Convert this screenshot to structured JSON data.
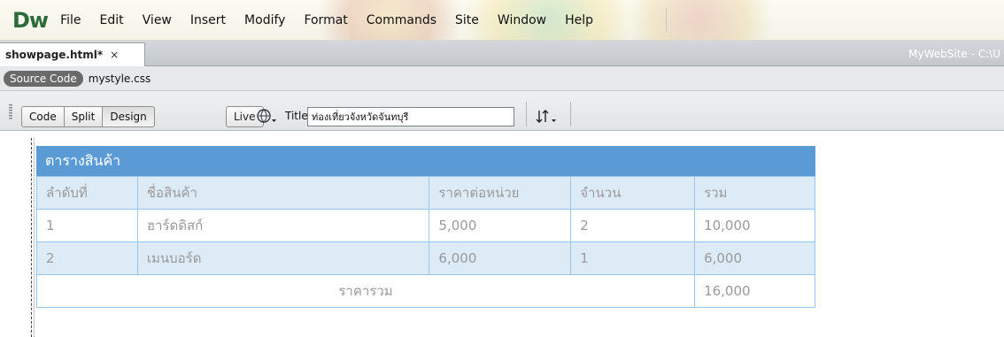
{
  "app": {
    "logo": "Dw"
  },
  "menu": [
    "File",
    "Edit",
    "View",
    "Insert",
    "Modify",
    "Format",
    "Commands",
    "Site",
    "Window",
    "Help"
  ],
  "doc_tab": {
    "filename": "showpage.html*",
    "close": "×"
  },
  "site_path": "MyWebSite - C:\\U",
  "related_files": {
    "source_code": "Source Code",
    "css_file": "mystyle.css"
  },
  "doc_toolbar": {
    "views": [
      "Code",
      "Split",
      "Design"
    ],
    "active_view": "Design",
    "live": "Live",
    "title_label": "Title:",
    "title_value": "ท่องเที่ยวจังหวัดจันทบุรี"
  },
  "table": {
    "caption": "ตารางสินค้า",
    "headers": [
      "ลำดับที่",
      "ชื่อสินค้า",
      "ราคาต่อหน่วย",
      "จำนวน",
      "รวม"
    ],
    "rows": [
      [
        "1",
        "ฮาร์ดดิสก์",
        "5,000",
        "2",
        "10,000"
      ],
      [
        "2",
        "เมนบอร์ด",
        "6,000",
        "1",
        "6,000"
      ]
    ],
    "total_label": "ราคารวม",
    "total_value": "16,000"
  },
  "colors": {
    "caption_bg": "#5b9bd5",
    "row_alt_bg": "#ddebf7",
    "border": "#9dc3e6",
    "dw_green": "#2d6b3a"
  }
}
